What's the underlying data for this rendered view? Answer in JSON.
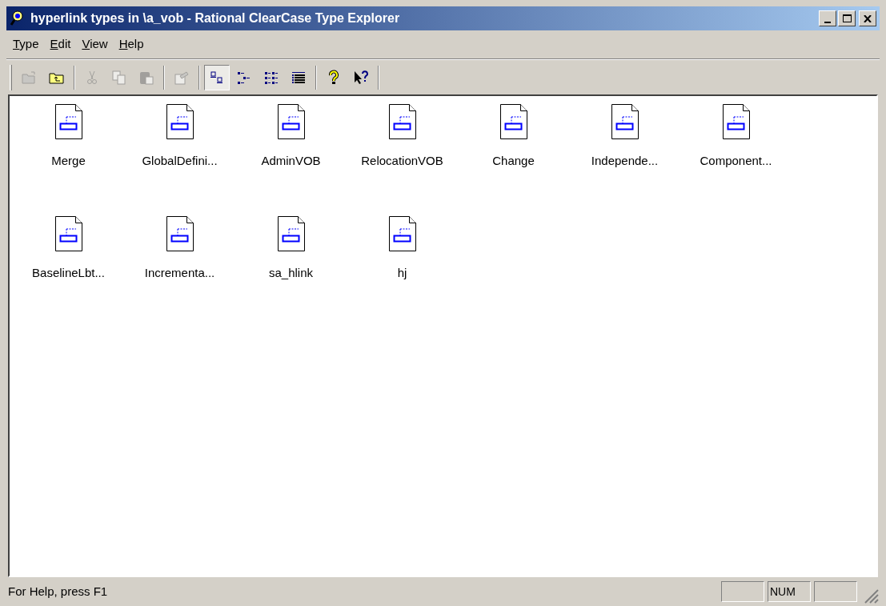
{
  "window": {
    "title": "hyperlink types in \\a_vob - Rational ClearCase Type Explorer"
  },
  "menu": [
    {
      "label": "Type"
    },
    {
      "label": "Edit"
    },
    {
      "label": "View"
    },
    {
      "label": "Help"
    }
  ],
  "toolbar": [
    {
      "kind": "open",
      "disabled": true,
      "selected": false
    },
    {
      "kind": "up",
      "disabled": false,
      "selected": false
    },
    {
      "kind": "separator"
    },
    {
      "kind": "cut",
      "disabled": true,
      "selected": false
    },
    {
      "kind": "copy",
      "disabled": true,
      "selected": false
    },
    {
      "kind": "paste",
      "disabled": true,
      "selected": false
    },
    {
      "kind": "separator"
    },
    {
      "kind": "properties",
      "disabled": true,
      "selected": false
    },
    {
      "kind": "separator"
    },
    {
      "kind": "largeicons",
      "disabled": false,
      "selected": true
    },
    {
      "kind": "smallicons",
      "disabled": false,
      "selected": false
    },
    {
      "kind": "list",
      "disabled": false,
      "selected": false
    },
    {
      "kind": "details",
      "disabled": false,
      "selected": false
    },
    {
      "kind": "separator"
    },
    {
      "kind": "help",
      "disabled": false,
      "selected": false
    },
    {
      "kind": "whatsthis",
      "disabled": false,
      "selected": false
    }
  ],
  "items": [
    {
      "label": "Merge"
    },
    {
      "label": "GlobalDefini..."
    },
    {
      "label": "AdminVOB"
    },
    {
      "label": "RelocationVOB"
    },
    {
      "label": "Change"
    },
    {
      "label": "Independe..."
    },
    {
      "label": "Component..."
    },
    {
      "label": "BaselineLbt..."
    },
    {
      "label": "Incrementa..."
    },
    {
      "label": "sa_hlink"
    },
    {
      "label": "hj"
    }
  ],
  "status_bar": {
    "message": "For Help, press F1",
    "panes": [
      {
        "kind": "empty"
      },
      {
        "kind": "text",
        "text": "NUM"
      },
      {
        "kind": "empty"
      }
    ]
  }
}
